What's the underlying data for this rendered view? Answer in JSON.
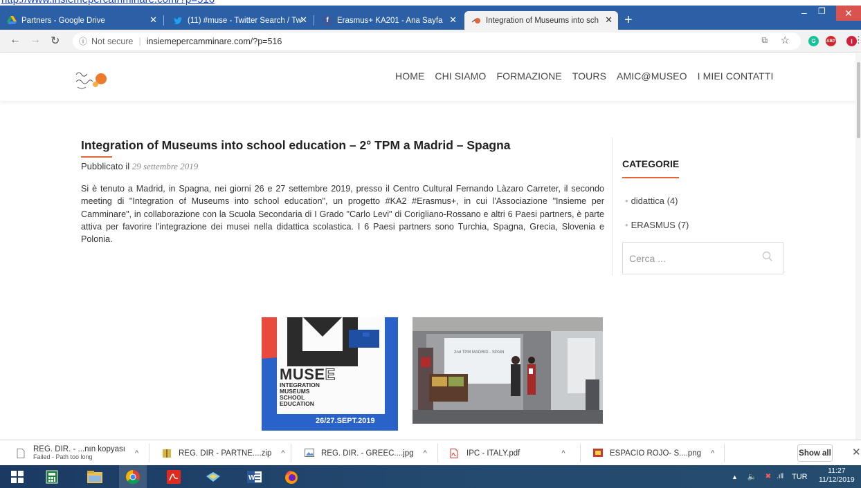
{
  "page_url_strip": "http://www.insiemepercamminare.com/?p=516",
  "tabs": [
    {
      "title": "Partners - Google Drive"
    },
    {
      "title": "(11) #muse - Twitter Search / Tw"
    },
    {
      "title": "Erasmus+ KA201 - Ana Sayfa"
    },
    {
      "title": "Integration of Museums into sch"
    }
  ],
  "toolbar": {
    "security": "Not secure",
    "url": "insiemepercamminare.com/?p=516",
    "profile_initial": "I"
  },
  "site": {
    "nav": [
      "HOME",
      "CHI SIAMO",
      "FORMAZIONE",
      "TOURS",
      "AMIC@MUSEO",
      "I MIEI CONTATTI"
    ]
  },
  "post": {
    "title": "Integration of Museums into school education – 2° TPM a Madrid – Spagna",
    "published_label": "Pubblicato il",
    "published_date": "29 settembre 2019",
    "body": "Si è tenuto a Madrid, in Spagna, nei giorni 26 e 27 settembre 2019, presso il Centro Cultural Fernando Làzaro Carreter, il secondo meeting di \"Integration of Museums into school education\", un progetto #KA2 #Erasmus+, in cui l'Associazione \"Insieme per Camminare\", in collaborazione con la Scuola Secondaria di I Grado \"Carlo Levi\" di Corigliano-Rossano e altri 6 Paesi partners, è parte attiva per favorire l'integrazione dei musei nella didattica scolastica. I 6 Paesi partners sono Turchia, Spagna, Grecia, Slovenia e Polonia."
  },
  "sidebar": {
    "heading": "CATEGORIE",
    "categories": [
      {
        "name": "didattica",
        "count": "(4)"
      },
      {
        "name": "ERASMUS",
        "count": "(7)"
      }
    ],
    "search_placeholder": "Cerca ..."
  },
  "poster": {
    "brand_main": "MUSE",
    "brand_suffix": "E",
    "lines": [
      "INTEGRATION",
      "MUSEUMS",
      "SCHOOL",
      "EDUCATION"
    ],
    "date": "26/27.SEPT.2019"
  },
  "photo": {
    "slide_text": "2nd TPM MADRID - SPAIN"
  },
  "downloads": [
    {
      "name": "REG. DIR. - ...nın kopyası",
      "status": "Failed - Path too long"
    },
    {
      "name": "REG. DIR - PARTNE....zip"
    },
    {
      "name": "REG. DIR. - GREEC....jpg"
    },
    {
      "name": "IPC - ITALY.pdf"
    },
    {
      "name": "ESPACIO ROJO- S....png"
    }
  ],
  "downloads_show_all": "Show all",
  "taskbar": {
    "lang": "TUR",
    "time": "11:27",
    "date": "11/12/2019"
  },
  "colors": {
    "accent": "#e6643a",
    "tabbar": "#2b5fa6"
  }
}
